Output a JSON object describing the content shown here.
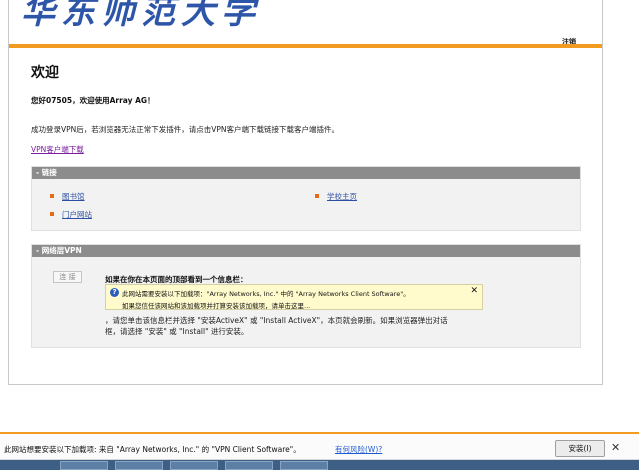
{
  "header": {
    "banner_text": "华东师范大学",
    "logout_label": "注销"
  },
  "main": {
    "title": "欢迎",
    "greeting": "您好07505，欢迎使用Array AG！",
    "info": "成功登录VPN后，若浏览器无法正常下发插件，请点击VPN客户端下载链接下载客户端插件。",
    "download_link": "VPN客户端下载"
  },
  "links_panel": {
    "header": "- 链接",
    "items": [
      {
        "label": "图书馆"
      },
      {
        "label": "学校主页"
      },
      {
        "label": "门户网站"
      }
    ]
  },
  "vpn_panel": {
    "header": "- 网络层VPN",
    "connect_label": "连 接",
    "heading": "如果在你在本页面的顶部看到一个信息栏：",
    "infobar_line1": "此网站需要安装以下加载项：\"Array Networks, Inc.\" 中的 \"Array Networks Client Software\"。",
    "infobar_line2": "如果您信任该网站和该加载项并打算安装该加载项，请单击这里...",
    "desc_line1": "，请您单击该信息栏并选择 \"安装ActiveX\" 或 \"Install ActiveX\"，本页就会刷新。如果浏览器弹出对话",
    "desc_line2": "框，请选择 \"安装\" 或 \"Install\" 进行安装。"
  },
  "notification": {
    "text": "此网站想要安装以下加载项: 来自 \"Array Networks, Inc.\" 的 \"VPN Client Software\"。",
    "risk_link": "有何风险(W)?",
    "install_label": "安装(I)",
    "close_glyph": "✕"
  },
  "colors": {
    "accent_orange": "#f39a21",
    "panel_header": "#8c8c8c",
    "link_blue": "#2a4fa3",
    "visited_purple": "#7a1fa2"
  },
  "icons": {
    "bullet": "square-bullet-icon",
    "info": "info-icon",
    "close": "close-icon"
  }
}
